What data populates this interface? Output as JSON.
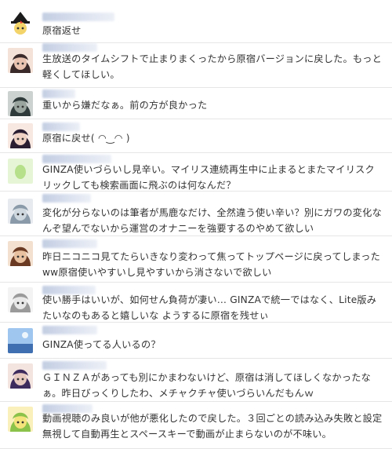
{
  "comments": [
    {
      "text": "原宿返せ",
      "avatar_icon": "witch-character-avatar-icon",
      "colors": [
        "#1b1b1b",
        "#f3d46a"
      ]
    },
    {
      "text": "生放送のタイムシフトで止まりまくったから原宿バージョンに戻した。もっと軽くしてほしい。",
      "avatar_icon": "dark-hair-character-avatar-icon",
      "colors": [
        "#3a2a2a",
        "#e9c3b0"
      ]
    },
    {
      "text": "重いから嫌だなぁ。前の方が良かった",
      "avatar_icon": "soldier-character-avatar-icon",
      "colors": [
        "#2f3b3a",
        "#9aa59f"
      ]
    },
    {
      "text": "原宿に戻せ( ◠‿◠ )",
      "avatar_icon": "glasses-girl-avatar-icon",
      "colors": [
        "#2a1e32",
        "#f0d2c4"
      ]
    },
    {
      "text": "GINZA使いづらいし見辛い。マイリス連続再生中に止まるとまたマイリスクリックしても検索画面に飛ぶのは何なんだ？",
      "avatar_icon": "default-egg-avatar-icon",
      "colors": [
        "#e6f5d6",
        "#b6e08a"
      ]
    },
    {
      "text": "変化が分らないのは筆者が馬鹿なだけ、全然違う使い辛い？別にガワの変化なんぞ望んでないから運営のオナニーを強要するのやめて欲しい",
      "avatar_icon": "mecha-avatar-icon",
      "colors": [
        "#8a9aa8",
        "#cfd8df"
      ]
    },
    {
      "text": "昨日ニコニコ見てたらいきなり変わって焦ってトップページに戻ってしまったww原宿使いやすいし見やすいから消さないで欲しい",
      "avatar_icon": "brown-hair-character-avatar-icon",
      "colors": [
        "#6b3a22",
        "#e8c2a0"
      ]
    },
    {
      "text": "使い勝手はいいが、如何せん負荷が凄い… GINZAで統一ではなく、Lite版みたいなのもあると嬉しいな ようするに原宿を残せぃ",
      "avatar_icon": "sketch-avatar-icon",
      "colors": [
        "#9a9a9a",
        "#e8e8e8"
      ]
    },
    {
      "text": "GINZA使ってる人いるの？",
      "avatar_icon": "sky-avatar-icon",
      "colors": [
        "#3f6fb0",
        "#9ec6ee"
      ]
    },
    {
      "text": "ＧＩＮＺＡがあっても別にかまわないけど、原宿は消してほしくなかったなぁ。昨日びっくりしたわ、メチャクチャ使いづらいんだもんｗ",
      "avatar_icon": "purple-hair-character-avatar-icon",
      "colors": [
        "#3e2b5e",
        "#e8c9c0"
      ]
    },
    {
      "text": "動画視聴のみ良いが他が悪化したので戻した。３回ごとの読み込み失敗と設定無視して自動再生とスペースキーで動画が止まらないのが不味い。",
      "avatar_icon": "fairy-character-avatar-icon",
      "colors": [
        "#8bc34a",
        "#f4e27a"
      ]
    }
  ]
}
